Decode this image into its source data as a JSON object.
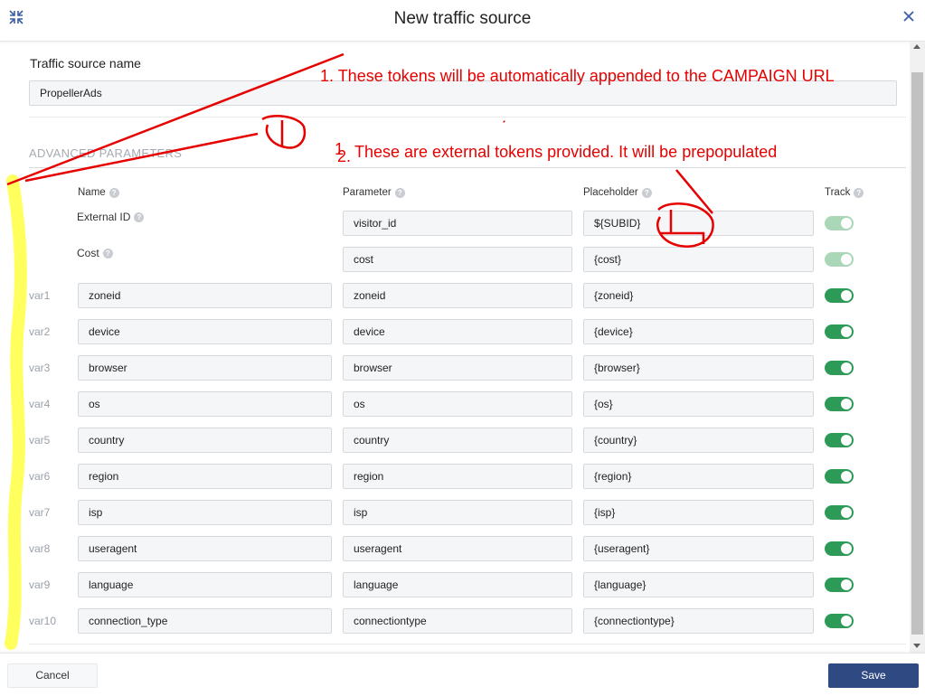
{
  "header": {
    "title": "New traffic source",
    "collapse_icon": "collapse-arrows-icon",
    "close_icon": "close-icon"
  },
  "form": {
    "name_label": "Traffic source name",
    "name_value": "PropellerAds",
    "advanced_title": "ADVANCED PARAMETERS",
    "columns": {
      "name": "Name",
      "parameter": "Parameter",
      "placeholder": "Placeholder",
      "track": "Track"
    },
    "static_rows": [
      {
        "name": "External ID",
        "parameter": "visitor_id",
        "placeholder": "${SUBID}",
        "track": true,
        "track_disabled": true
      },
      {
        "name": "Cost",
        "parameter": "cost",
        "placeholder": "{cost}",
        "track": true,
        "track_disabled": true
      }
    ],
    "var_rows": [
      {
        "var": "var1",
        "name": "zoneid",
        "parameter": "zoneid",
        "placeholder": "{zoneid}",
        "track": true
      },
      {
        "var": "var2",
        "name": "device",
        "parameter": "device",
        "placeholder": "{device}",
        "track": true
      },
      {
        "var": "var3",
        "name": "browser",
        "parameter": "browser",
        "placeholder": "{browser}",
        "track": true
      },
      {
        "var": "var4",
        "name": "os",
        "parameter": "os",
        "placeholder": "{os}",
        "track": true
      },
      {
        "var": "var5",
        "name": "country",
        "parameter": "country",
        "placeholder": "{country}",
        "track": true
      },
      {
        "var": "var6",
        "name": "region",
        "parameter": "region",
        "placeholder": "{region}",
        "track": true
      },
      {
        "var": "var7",
        "name": "isp",
        "parameter": "isp",
        "placeholder": "{isp}",
        "track": true
      },
      {
        "var": "var8",
        "name": "useragent",
        "parameter": "useragent",
        "placeholder": "{useragent}",
        "track": true
      },
      {
        "var": "var9",
        "name": "language",
        "parameter": "language",
        "placeholder": "{language}",
        "track": true
      },
      {
        "var": "var10",
        "name": "connection_type",
        "parameter": "connectiontype",
        "placeholder": "{connectiontype}",
        "track": true
      }
    ]
  },
  "footer": {
    "cancel_label": "Cancel",
    "save_label": "Save"
  },
  "annotations": {
    "note1": "1. These tokens will be automatically appended to the CAMPAIGN URL",
    "note2_prefix": "1",
    "note2_number": "2.",
    "note2_text": "These are external tokens provided. It will be prepopulated",
    "color": "#e60000",
    "highlight_color": "#ffff4d"
  }
}
